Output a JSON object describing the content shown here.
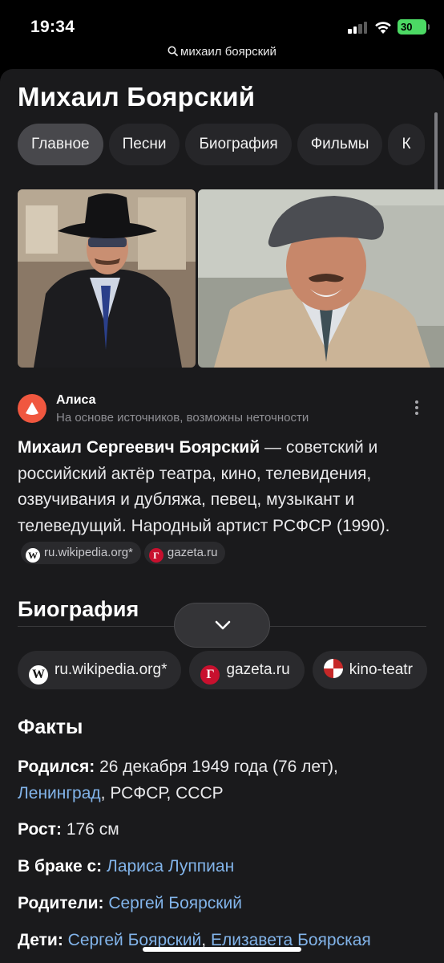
{
  "status_bar": {
    "time": "19:34",
    "battery": "30",
    "battery_level": 0.3
  },
  "url_bar": {
    "query": "михаил боярский"
  },
  "page": {
    "title": "Михаил Боярский"
  },
  "tabs": [
    {
      "label": "Главное",
      "active": true
    },
    {
      "label": "Песни"
    },
    {
      "label": "Биография"
    },
    {
      "label": "Фильмы"
    },
    {
      "label": "К"
    }
  ],
  "alice": {
    "name": "Алиса",
    "note": "На основе источников, возможны неточности",
    "summary_bold": "Михаил Сергеевич Боярский",
    "summary_text": " — советский и российский актёр театра, кино, телевидения, озвучивания и дубляжа, певец, музыкант и телеведущий. Народный артист РСФСР (1990).",
    "sources": [
      "ru.wikipedia.org*",
      "gazeta.ru"
    ]
  },
  "biography": {
    "heading": "Биография",
    "sources": [
      "ru.wikipedia.org*",
      "gazeta.ru",
      "kino-teatr"
    ]
  },
  "facts": {
    "heading": "Факты",
    "born_label": "Родился:",
    "born_text": " 26 декабря 1949 года (76 лет),",
    "born_city": "Ленинград",
    "born_rest": ", РСФСР, СССР",
    "height_label": "Рост:",
    "height_value": " 176 см",
    "married_label": "В браке с:",
    "married_value": "Лариса Луппиан",
    "parents_label": "Родители:",
    "parents_value": "Сергей Боярский",
    "children_label": "Дети:",
    "children_value_1": "Сергей Боярский",
    "children_sep": ", ",
    "children_value_2": "Елизавета Боярская"
  },
  "colors": {
    "background": "#1a1a1c",
    "chip": "#2a2a2d",
    "link": "#82b4ea",
    "alice_brand": "#f0573f",
    "battery": "#4cd964"
  }
}
